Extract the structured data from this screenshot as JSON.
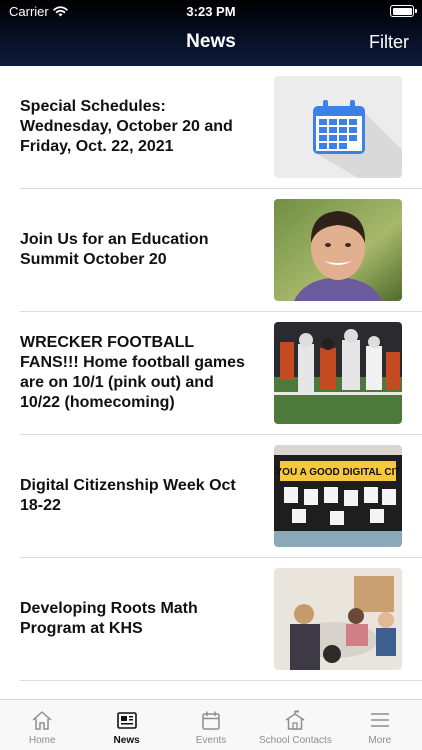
{
  "status_bar": {
    "carrier": "Carrier",
    "time": "3:23 PM"
  },
  "nav": {
    "title": "News",
    "filter_label": "Filter"
  },
  "news_items": [
    {
      "title": "Special Schedules: Wednesday, October 20 and Friday, Oct. 22, 2021",
      "thumbnail": "calendar-icon"
    },
    {
      "title": "Join Us for an Education Summit October 20",
      "thumbnail": "portrait-photo"
    },
    {
      "title": "WRECKER FOOTBALL FANS!!! Home football games are on 10/1 (pink out) and 10/22 (homecoming)",
      "thumbnail": "football-game-photo"
    },
    {
      "title": "Digital Citizenship Week Oct 18-22",
      "thumbnail": "bulletin-board-photo"
    },
    {
      "title": "Developing Roots Math Program at KHS",
      "thumbnail": "classroom-photo"
    }
  ],
  "tab_bar": {
    "tabs": [
      {
        "label": "Home",
        "icon": "home-icon"
      },
      {
        "label": "News",
        "icon": "newspaper-icon",
        "active": true
      },
      {
        "label": "Events",
        "icon": "calendar-icon"
      },
      {
        "label": "School Contacts",
        "icon": "school-icon"
      },
      {
        "label": "More",
        "icon": "menu-icon"
      }
    ]
  },
  "colors": {
    "header_bg": "#0e1c3c",
    "header_text": "#ffffff",
    "calendar_blue": "#3b82e8",
    "tab_inactive": "#8e8e93",
    "tab_active": "#111111"
  },
  "images": {
    "bulletin_board_text": "YOU A GOOD DIGITAL CIT"
  }
}
